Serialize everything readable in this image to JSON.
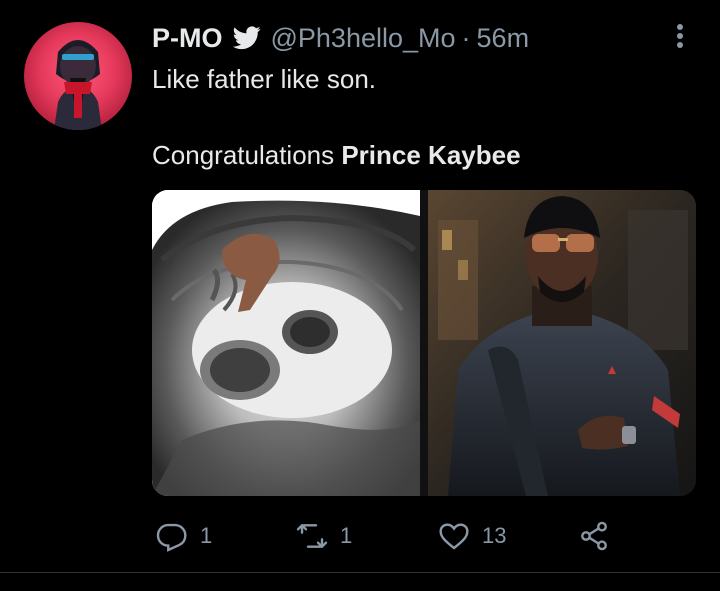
{
  "tweet": {
    "display_name": "P-MO",
    "handle": "@Ph3hello_Mo",
    "separator": "·",
    "time": "56m",
    "text_line1": "Like father like son.",
    "text_line2_prefix": "Congratulations ",
    "text_line2_mention": "Prince Kaybee",
    "verified_icon": "verified-bird-icon",
    "more_icon": "more-vertical-icon"
  },
  "media": {
    "left_image": "ultrasound-image",
    "right_image": "man-in-leather-jacket-photo"
  },
  "actions": {
    "reply_count": "1",
    "retweet_count": "1",
    "like_count": "13",
    "reply_icon": "reply-icon",
    "retweet_icon": "retweet-icon",
    "like_icon": "heart-icon",
    "share_icon": "share-icon"
  },
  "colors": {
    "background": "#000000",
    "primary_text": "#e7e9ea",
    "secondary_text": "#8b98a5",
    "avatar_bg": "#e63a5c"
  }
}
